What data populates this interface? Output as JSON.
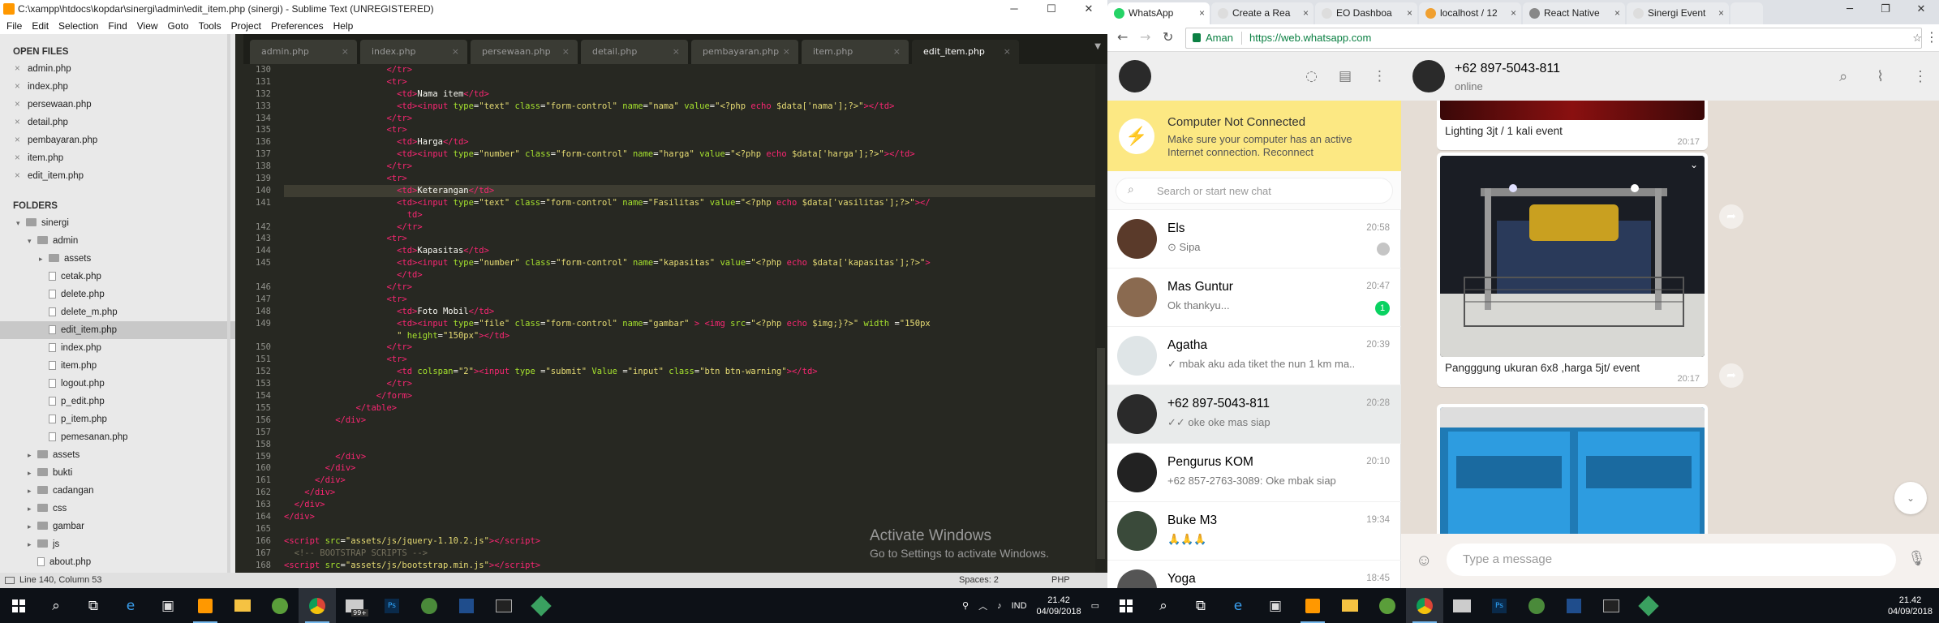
{
  "sublime": {
    "title": "C:\\xampp\\htdocs\\kopdar\\sinergi\\admin\\edit_item.php (sinergi) - Sublime Text (UNREGISTERED)",
    "window_btns": [
      "─",
      "☐",
      "✕"
    ],
    "menu": [
      "File",
      "Edit",
      "Selection",
      "Find",
      "View",
      "Goto",
      "Tools",
      "Project",
      "Preferences",
      "Help"
    ],
    "open_files_header": "OPEN FILES",
    "open_files": [
      "admin.php",
      "index.php",
      "persewaan.php",
      "detail.php",
      "pembayaran.php",
      "item.php",
      "edit_item.php"
    ],
    "folders_header": "FOLDERS",
    "tree": [
      {
        "label": "sinergi",
        "type": "folder",
        "depth": 0,
        "arrow": "▾"
      },
      {
        "label": "admin",
        "type": "folder",
        "depth": 1,
        "arrow": "▾"
      },
      {
        "label": "assets",
        "type": "folder",
        "depth": 2,
        "arrow": "▸"
      },
      {
        "label": "cetak.php",
        "type": "file",
        "depth": 2
      },
      {
        "label": "delete.php",
        "type": "file",
        "depth": 2
      },
      {
        "label": "delete_m.php",
        "type": "file",
        "depth": 2
      },
      {
        "label": "edit_item.php",
        "type": "file",
        "depth": 2,
        "selected": true
      },
      {
        "label": "index.php",
        "type": "file",
        "depth": 2
      },
      {
        "label": "item.php",
        "type": "file",
        "depth": 2
      },
      {
        "label": "logout.php",
        "type": "file",
        "depth": 2
      },
      {
        "label": "p_edit.php",
        "type": "file",
        "depth": 2
      },
      {
        "label": "p_item.php",
        "type": "file",
        "depth": 2
      },
      {
        "label": "pemesanan.php",
        "type": "file",
        "depth": 2
      },
      {
        "label": "assets",
        "type": "folder",
        "depth": 1,
        "arrow": "▸"
      },
      {
        "label": "bukti",
        "type": "folder",
        "depth": 1,
        "arrow": "▸"
      },
      {
        "label": "cadangan",
        "type": "folder",
        "depth": 1,
        "arrow": "▸"
      },
      {
        "label": "css",
        "type": "folder",
        "depth": 1,
        "arrow": "▸"
      },
      {
        "label": "gambar",
        "type": "folder",
        "depth": 1,
        "arrow": "▸"
      },
      {
        "label": "js",
        "type": "folder",
        "depth": 1,
        "arrow": "▸"
      },
      {
        "label": "about.php",
        "type": "file",
        "depth": 1
      }
    ],
    "tabs": [
      {
        "label": "admin.php",
        "active": false
      },
      {
        "label": "index.php",
        "active": false
      },
      {
        "label": "persewaan.php",
        "active": false
      },
      {
        "label": "detail.php",
        "active": false
      },
      {
        "label": "pembayaran.php",
        "active": false
      },
      {
        "label": "item.php",
        "active": false
      },
      {
        "label": "edit_item.php",
        "active": true
      }
    ],
    "code_lines": [
      {
        "n": "130",
        "html": "                    <span class='t'>&lt;/tr&gt;</span>"
      },
      {
        "n": "131",
        "html": "                    <span class='t'>&lt;tr&gt;</span>"
      },
      {
        "n": "132",
        "html": "                      <span class='t'>&lt;td&gt;</span>Nama item<span class='t'>&lt;/td&gt;</span>"
      },
      {
        "n": "133",
        "html": "                      <span class='t'>&lt;td&gt;&lt;input</span> <span class='a'>type</span>=<span class='s'>\"text\"</span> <span class='a'>class</span>=<span class='s'>\"form-control\"</span> <span class='a'>name</span>=<span class='s'>\"nama\"</span> <span class='a'>value</span>=<span class='s'>\"&lt;?php <span class='t'>echo</span> $data['nama'];?&gt;\"</span><span class='t'>&gt;&lt;/td&gt;</span>"
      },
      {
        "n": "134",
        "html": "                    <span class='t'>&lt;/tr&gt;</span>"
      },
      {
        "n": "135",
        "html": "                    <span class='t'>&lt;tr&gt;</span>"
      },
      {
        "n": "136",
        "html": "                      <span class='t'>&lt;td&gt;</span>Harga<span class='t'>&lt;/td&gt;</span>"
      },
      {
        "n": "137",
        "html": "                      <span class='t'>&lt;td&gt;&lt;input</span> <span class='a'>type</span>=<span class='s'>\"number\"</span> <span class='a'>class</span>=<span class='s'>\"form-control\"</span> <span class='a'>name</span>=<span class='s'>\"harga\"</span> <span class='a'>value</span>=<span class='s'>\"&lt;?php <span class='t'>echo</span> $data['harga'];?&gt;\"</span><span class='t'>&gt;&lt;/td&gt;</span>"
      },
      {
        "n": "138",
        "html": "                    <span class='t'>&lt;/tr&gt;</span>"
      },
      {
        "n": "139",
        "html": "                    <span class='t'>&lt;tr&gt;</span>"
      },
      {
        "n": "140",
        "html": "                      <span class='t'>&lt;td&gt;</span>Keterangan<span class='t'>&lt;/td&gt;</span>",
        "cur": true
      },
      {
        "n": "141",
        "html": "                      <span class='t'>&lt;td&gt;&lt;input</span> <span class='a'>type</span>=<span class='s'>\"text\"</span> <span class='a'>class</span>=<span class='s'>\"form-control\"</span> <span class='a'>name</span>=<span class='s'>\"Fasilitas\"</span> <span class='a'>value</span>=<span class='s'>\"&lt;?php <span class='t'>echo</span> $data['vasilitas'];?&gt;\"</span><span class='t'>&gt;&lt;/</span>"
      },
      {
        "n": "",
        "html": "                        <span class='t'>td&gt;</span>"
      },
      {
        "n": "142",
        "html": "                      <span class='t'>&lt;/tr&gt;</span>"
      },
      {
        "n": "143",
        "html": "                    <span class='t'>&lt;tr&gt;</span>"
      },
      {
        "n": "144",
        "html": "                      <span class='t'>&lt;td&gt;</span>Kapasitas<span class='t'>&lt;/td&gt;</span>"
      },
      {
        "n": "145",
        "html": "                      <span class='t'>&lt;td&gt;&lt;input</span> <span class='a'>type</span>=<span class='s'>\"number\"</span> <span class='a'>class</span>=<span class='s'>\"form-control\"</span> <span class='a'>name</span>=<span class='s'>\"kapasitas\"</span> <span class='a'>value</span>=<span class='s'>\"&lt;?php <span class='t'>echo</span> $data['kapasitas'];?&gt;\"</span><span class='t'>&gt;</span>"
      },
      {
        "n": "",
        "html": "                      <span class='t'>&lt;/td&gt;</span>"
      },
      {
        "n": "146",
        "html": "                    <span class='t'>&lt;/tr&gt;</span>"
      },
      {
        "n": "147",
        "html": "                    <span class='t'>&lt;tr&gt;</span>"
      },
      {
        "n": "148",
        "html": "                      <span class='t'>&lt;td&gt;</span>Foto Mobil<span class='t'>&lt;/td&gt;</span>"
      },
      {
        "n": "149",
        "html": "                      <span class='t'>&lt;td&gt;&lt;input</span> <span class='a'>type</span>=<span class='s'>\"file\"</span> <span class='a'>class</span>=<span class='s'>\"form-control\"</span> <span class='a'>name</span>=<span class='s'>\"gambar\"</span> <span class='t'>&gt;</span> <span class='t'>&lt;img</span> <span class='a'>src</span>=<span class='s'>\"&lt;?php <span class='t'>echo</span> $img;}?&gt;\"</span> <span class='a'>width</span> =<span class='s'>\"150px</span>"
      },
      {
        "n": "",
        "html": "                      <span class='s'>\"</span> <span class='a'>height</span>=<span class='s'>\"150px\"</span><span class='t'>&gt;&lt;/td&gt;</span>"
      },
      {
        "n": "150",
        "html": "                    <span class='t'>&lt;/tr&gt;</span>"
      },
      {
        "n": "151",
        "html": "                    <span class='t'>&lt;tr&gt;</span>"
      },
      {
        "n": "152",
        "html": "                      <span class='t'>&lt;td</span> <span class='a'>colspan</span>=<span class='s'>\"2\"</span><span class='t'>&gt;&lt;input</span> <span class='a'>type</span> =<span class='s'>\"submit\"</span> <span class='a'>Value</span> =<span class='s'>\"input\"</span> <span class='a'>class</span>=<span class='s'>\"btn btn-warning\"</span><span class='t'>&gt;&lt;/td&gt;</span>"
      },
      {
        "n": "153",
        "html": "                    <span class='t'>&lt;/tr&gt;</span>"
      },
      {
        "n": "154",
        "html": "                  <span class='t'>&lt;/form&gt;</span>"
      },
      {
        "n": "155",
        "html": "              <span class='t'>&lt;/table&gt;</span>"
      },
      {
        "n": "156",
        "html": "          <span class='t'>&lt;/div&gt;</span>"
      },
      {
        "n": "157",
        "html": ""
      },
      {
        "n": "158",
        "html": ""
      },
      {
        "n": "159",
        "html": "          <span class='t'>&lt;/div&gt;</span>"
      },
      {
        "n": "160",
        "html": "        <span class='t'>&lt;/div&gt;</span>"
      },
      {
        "n": "161",
        "html": "      <span class='t'>&lt;/div&gt;</span>"
      },
      {
        "n": "162",
        "html": "    <span class='t'>&lt;/div&gt;</span>"
      },
      {
        "n": "163",
        "html": "  <span class='t'>&lt;/div&gt;</span>"
      },
      {
        "n": "164",
        "html": "<span class='t'>&lt;/div&gt;</span>"
      },
      {
        "n": "165",
        "html": ""
      },
      {
        "n": "166",
        "html": "<span class='t'>&lt;script</span> <span class='a'>src</span>=<span class='s'>\"assets/js/jquery-1.10.2.js\"</span><span class='t'>&gt;&lt;/script&gt;</span>"
      },
      {
        "n": "167",
        "html": "  <span class='c'>&lt;!-- BOOTSTRAP SCRIPTS --&gt;</span>"
      },
      {
        "n": "168",
        "html": "<span class='t'>&lt;script</span> <span class='a'>src</span>=<span class='s'>\"assets/js/bootstrap.min.js\"</span><span class='t'>&gt;&lt;/script&gt;</span>"
      }
    ],
    "activate_title": "Activate Windows",
    "activate_sub": "Go to Settings to activate Windows.",
    "status_left": "Line 140, Column 53",
    "status_spaces": "Spaces: 2",
    "status_syntax": "PHP"
  },
  "taskbar_left": {
    "time": "21.42",
    "date": "04/09/2018",
    "lang": "IND",
    "badge": "99+"
  },
  "taskbar_right": {
    "time": "21.42",
    "date": "04/09/2018"
  },
  "chrome": {
    "tabs": [
      {
        "label": "WhatsApp",
        "active": true,
        "color": "#25d366"
      },
      {
        "label": "Create a Rea",
        "active": false,
        "color": "#ddd"
      },
      {
        "label": "EO Dashboa",
        "active": false,
        "color": "#ddd"
      },
      {
        "label": "localhost / 12",
        "active": false,
        "color": "#f0a030"
      },
      {
        "label": "React Native",
        "active": false,
        "color": "#888"
      },
      {
        "label": "Sinergi Event",
        "active": false,
        "color": "#ddd"
      }
    ],
    "security": "Aman",
    "url": "https://web.whatsapp.com"
  },
  "whatsapp": {
    "notice_title": "Computer Not Connected",
    "notice_body": "Make sure your computer has an active Internet connection. Reconnect",
    "search_placeholder": "Search or start new chat",
    "chats": [
      {
        "name": "Els",
        "time": "20:58",
        "last": "⊙ Sipa",
        "pin": true,
        "bg": "#5a3a2a"
      },
      {
        "name": "Mas Guntur",
        "time": "20:47",
        "last": "Ok thankyu...",
        "badge": "1",
        "bg": "#8a6a50"
      },
      {
        "name": "Agatha",
        "time": "20:39",
        "last": "✓ mbak aku ada tiket the nun 1 km ma...",
        "bg": "#dfe5e7"
      },
      {
        "name": "+62 897-5043-811",
        "time": "20:28",
        "last": "✓✓ oke oke mas siap",
        "selected": true,
        "bg": "#2a2a2a"
      },
      {
        "name": "Pengurus KOM",
        "time": "20:10",
        "last": "+62 857-2763-3089: Oke mbak siap",
        "bg": "#222"
      },
      {
        "name": "Buke M3",
        "time": "19:34",
        "last": "🙏🙏🙏",
        "bg": "#3a4a3a"
      },
      {
        "name": "Yoga",
        "time": "18:45",
        "last": "",
        "bg": "#555"
      }
    ],
    "contact_name": "+62 897-5043-811",
    "contact_status": "online",
    "messages": [
      {
        "caption": "Lighting 3jt / 1 kali event",
        "time": "20:17"
      },
      {
        "caption": "Pangggung ukuran 6x8 ,harga 5jt/ event",
        "time": "20:17"
      },
      {
        "caption": "",
        "time": ""
      }
    ],
    "compose_placeholder": "Type a message"
  }
}
